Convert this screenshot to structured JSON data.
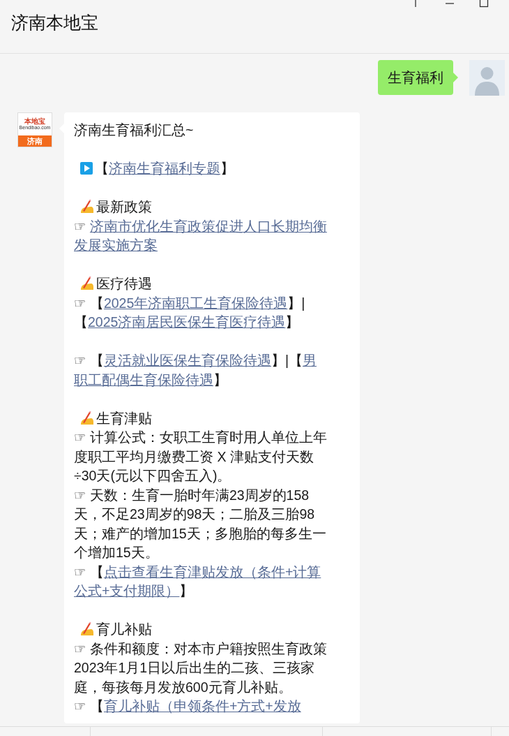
{
  "window": {
    "title": "济南本地宝"
  },
  "messages": [
    {
      "kind": "sent",
      "text": "生育福利"
    },
    {
      "kind": "received",
      "logo": {
        "top": "本地宝",
        "site": "Bendibao.com",
        "city": "济南"
      },
      "blocks": [
        [
          {
            "lines": [
              [
                {
                  "text": "济南生育福利汇总~",
                  "link": false
                }
              ]
            ]
          }
        ],
        [
          {
            "kind": "play",
            "lines": [
              [
                {
                  "text": "【",
                  "link": false
                },
                {
                  "text": "济南生育福利专题",
                  "link": true
                },
                {
                  "text": "】",
                  "link": false
                }
              ]
            ]
          }
        ],
        [
          {
            "kind": "heading",
            "lines": [
              [
                {
                  "text": "最新政策",
                  "link": false
                }
              ]
            ]
          },
          {
            "lines": [
              [
                {
                  "text": "☞ ",
                  "link": false
                },
                {
                  "text": "济南市优化生育政策促进人口长期均衡",
                  "link": true
                }
              ],
              [
                {
                  "text": "发展实施方案",
                  "link": true
                }
              ]
            ]
          }
        ],
        [
          {
            "kind": "heading",
            "lines": [
              [
                {
                  "text": "医疗待遇",
                  "link": false
                }
              ]
            ]
          },
          {
            "lines": [
              [
                {
                  "text": "☞ 【",
                  "link": false
                },
                {
                  "text": "2025年济南职工生育保险待遇",
                  "link": true
                },
                {
                  "text": "】|",
                  "link": false
                }
              ],
              [
                {
                  "text": "【",
                  "link": false
                },
                {
                  "text": "2025济南居民医保生育医疗待遇",
                  "link": true
                },
                {
                  "text": "】",
                  "link": false
                }
              ]
            ]
          }
        ],
        [
          {
            "lines": [
              [
                {
                  "text": "☞ 【",
                  "link": false
                },
                {
                  "text": "灵活就业医保生育保险待遇",
                  "link": true
                },
                {
                  "text": "】|【",
                  "link": false
                },
                {
                  "text": "男",
                  "link": true
                }
              ],
              [
                {
                  "text": "职工配偶生育保险待遇",
                  "link": true
                },
                {
                  "text": "】",
                  "link": false
                }
              ]
            ]
          }
        ],
        [
          {
            "kind": "heading",
            "lines": [
              [
                {
                  "text": "生育津贴",
                  "link": false
                }
              ]
            ]
          },
          {
            "lines": [
              [
                {
                  "text": "☞ 计算公式：女职工生育时用人单位上年",
                  "link": false
                }
              ],
              [
                {
                  "text": "度职工平均月缴费工资 X 津贴支付天数",
                  "link": false
                }
              ],
              [
                {
                  "text": "÷30天(元以下四舍五入)。",
                  "link": false
                }
              ]
            ]
          },
          {
            "lines": [
              [
                {
                  "text": "☞ 天数：生育一胎时年满23周岁的158",
                  "link": false
                }
              ],
              [
                {
                  "text": "天，不足23周岁的98天；二胎及三胎98",
                  "link": false
                }
              ],
              [
                {
                  "text": "天；难产的增加15天；多胞胎的每多生一",
                  "link": false
                }
              ],
              [
                {
                  "text": "个增加15天。",
                  "link": false
                }
              ]
            ]
          },
          {
            "lines": [
              [
                {
                  "text": "☞ 【",
                  "link": false
                },
                {
                  "text": "点击查看生育津贴发放（条件+计算",
                  "link": true
                }
              ],
              [
                {
                  "text": "公式+支付期限）",
                  "link": true
                },
                {
                  "text": "】",
                  "link": false
                }
              ]
            ]
          }
        ],
        [
          {
            "kind": "heading",
            "lines": [
              [
                {
                  "text": "育儿补贴",
                  "link": false
                }
              ]
            ]
          },
          {
            "lines": [
              [
                {
                  "text": "☞ 条件和额度：对本市户籍按照生育政策",
                  "link": false
                }
              ],
              [
                {
                  "text": "2023年1月1日以后出生的二孩、三孩家",
                  "link": false
                }
              ],
              [
                {
                  "text": "庭，每孩每月发放600元育儿补贴。",
                  "link": false
                }
              ]
            ]
          },
          {
            "lines": [
              [
                {
                  "text": "☞ 【",
                  "link": false
                },
                {
                  "text": "育儿补贴（申领条件+方式+发放",
                  "link": true
                }
              ]
            ]
          }
        ]
      ]
    }
  ]
}
